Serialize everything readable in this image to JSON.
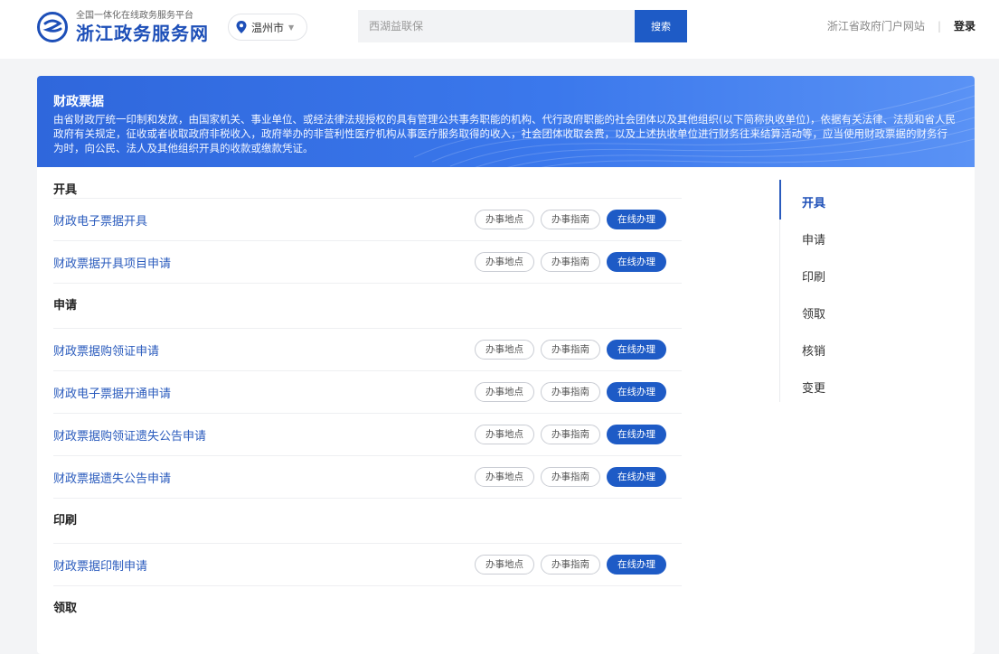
{
  "header": {
    "logo_sub": "全国一体化在线政务服务平台",
    "logo_main": "浙江政务服务网",
    "city": "温州市",
    "search_placeholder": "西湖益联保",
    "search_button": "搜索",
    "portal_link": "浙江省政府门户网站",
    "separator": "|",
    "login": "登录"
  },
  "banner": {
    "title": "财政票据",
    "description": "由省财政厅统一印制和发放，由国家机关、事业单位、或经法律法规授权的具有管理公共事务职能的机构、代行政府职能的社会团体以及其他组织(以下简称执收单位)，依据有关法律、法规和省人民政府有关规定，征收或者收取政府非税收入，政府举办的非营利性医疗机构从事医疗服务取得的收入，社会团体收取会费，以及上述执收单位进行财务往来结算活动等，应当使用财政票据的财务行为时，向公民、法人及其他组织开具的收款或缴款凭证。"
  },
  "buttons": {
    "location": "办事地点",
    "guide": "办事指南",
    "online": "在线办理"
  },
  "sections": [
    {
      "title": "开具",
      "items": [
        "财政电子票据开具",
        "财政票据开具项目申请"
      ]
    },
    {
      "title": "申请",
      "items": [
        "财政票据购领证申请",
        "财政电子票据开通申请",
        "财政票据购领证遗失公告申请",
        "财政票据遗失公告申请"
      ]
    },
    {
      "title": "印刷",
      "items": [
        "财政票据印制申请"
      ]
    },
    {
      "title": "领取",
      "items": []
    }
  ],
  "sidenav": {
    "items": [
      "开具",
      "申请",
      "印刷",
      "领取",
      "核销",
      "变更"
    ],
    "active": "开具"
  },
  "colors": {
    "brand": "#1d4fb8",
    "primary_button": "#1e5bc6",
    "link": "#2a5bbd",
    "banner_start": "#2f67dc",
    "banner_end": "#5a92f5"
  }
}
